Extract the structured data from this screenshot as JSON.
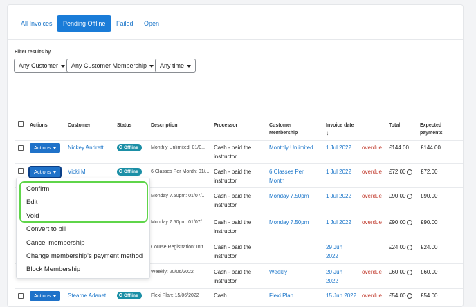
{
  "tabs": [
    "All Invoices",
    "Pending Offline",
    "Failed",
    "Open"
  ],
  "filters": {
    "label": "Filter results by",
    "customer": "Any Customer",
    "membership": "Any Customer Membership",
    "time": "Any time"
  },
  "table": {
    "headers": {
      "actions": "Actions",
      "customer": "Customer",
      "status": "Status",
      "description": "Description",
      "processor": "Processor",
      "membership_l1": "Customer",
      "membership_l2": "Membership",
      "invoice_date": "Invoice date",
      "total": "Total",
      "expected_l1": "Expected",
      "expected_l2": "payments"
    },
    "actions_label": "Actions",
    "offline_label": "Offline",
    "info_icon_glyph": "i",
    "rows": [
      {
        "customer": "Nickey Andretti",
        "status": "Offline",
        "description": "Monthly Unlimited: 01/0...",
        "processor_l1": "Cash - paid the",
        "processor_l2": "instructor",
        "membership_l1": "Monthly Unlimited",
        "membership_l2": "",
        "date_l1": "1 Jul 2022",
        "date_l2": "",
        "overdue": "overdue",
        "total": "£144.00",
        "expected": "£144.00"
      },
      {
        "customer": "Vicki M",
        "status": "Offline",
        "description": "6 Classes Per Month: 01/...",
        "processor_l1": "Cash - paid the",
        "processor_l2": "instructor",
        "membership_l1": "6 Classes Per",
        "membership_l2": "Month",
        "date_l1": "1 Jul 2022",
        "date_l2": "",
        "overdue": "overdue",
        "total": "£72.00",
        "expected": "£72.00"
      },
      {
        "customer": "",
        "status": "",
        "description": "Monday 7.50pm: 01/07/...",
        "processor_l1": "Cash - paid the",
        "processor_l2": "instructor",
        "membership_l1": "Monday 7.50pm",
        "membership_l2": "",
        "date_l1": "1 Jul 2022",
        "date_l2": "",
        "overdue": "overdue",
        "total": "£90.00",
        "expected": "£90.00"
      },
      {
        "customer": "",
        "status": "",
        "description": "Monday 7.50pm: 01/07/...",
        "processor_l1": "Cash - paid the",
        "processor_l2": "instructor",
        "membership_l1": "Monday 7.50pm",
        "membership_l2": "",
        "date_l1": "1 Jul 2022",
        "date_l2": "",
        "overdue": "overdue",
        "total": "£90.00",
        "expected": "£90.00"
      },
      {
        "customer": "",
        "status": "",
        "description": "Course Registration: Intr...",
        "processor_l1": "Cash - paid the",
        "processor_l2": "instructor",
        "membership_l1": "",
        "membership_l2": "",
        "date_l1": "29 Jun",
        "date_l2": "2022",
        "overdue": "",
        "total": "£24.00",
        "expected": "£24.00"
      },
      {
        "customer": "",
        "status": "",
        "description": "Weekly: 20/06/2022",
        "processor_l1": "Cash - paid the",
        "processor_l2": "instructor",
        "membership_l1": "Weekly",
        "membership_l2": "",
        "date_l1": "20 Jun",
        "date_l2": "2022",
        "overdue": "overdue",
        "total": "£60.00",
        "expected": "£60.00"
      },
      {
        "customer": "Stearne Adanet",
        "status": "Offline",
        "description": "Flexi Plan: 15/06/2022",
        "processor_l1": "Cash",
        "processor_l2": "",
        "membership_l1": "Flexi Plan",
        "membership_l2": "",
        "date_l1": "15 Jun 2022",
        "date_l2": "",
        "overdue": "overdue",
        "total": "£54.00",
        "expected": "£54.00"
      }
    ]
  },
  "menu": {
    "items": [
      "Confirm",
      "Edit",
      "Void",
      "Convert to bill",
      "Cancel membership",
      "Change membership's payment method",
      "Block Membership"
    ]
  },
  "colors": {
    "accent": "#1a7cd8",
    "overdue": "#c0392b",
    "badge": "#1b8fa6",
    "highlight": "#5fd54a"
  }
}
